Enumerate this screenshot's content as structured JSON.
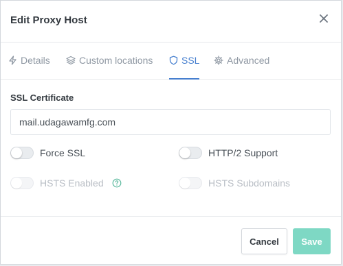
{
  "dialog": {
    "title": "Edit Proxy Host"
  },
  "tabs": [
    {
      "label": "Details",
      "icon": "bolt-icon",
      "active": false
    },
    {
      "label": "Custom locations",
      "icon": "layers-icon",
      "active": false
    },
    {
      "label": "SSL",
      "icon": "shield-icon",
      "active": true
    },
    {
      "label": "Advanced",
      "icon": "gear-icon",
      "active": false
    }
  ],
  "ssl": {
    "certificate_label": "SSL Certificate",
    "certificate_value": "mail.udagawamfg.com",
    "toggles": [
      {
        "label": "Force SSL",
        "enabled": false,
        "disabled": false
      },
      {
        "label": "HTTP/2 Support",
        "enabled": false,
        "disabled": false
      },
      {
        "label": "HSTS Enabled",
        "enabled": false,
        "disabled": true,
        "help_icon": "help-circle-icon"
      },
      {
        "label": "HSTS Subdomains",
        "enabled": false,
        "disabled": true
      }
    ]
  },
  "footer": {
    "cancel_label": "Cancel",
    "save_label": "Save"
  },
  "colors": {
    "accent": "#467fcf",
    "save_button": "#7ed8c4",
    "help_icon": "#5eba9f"
  }
}
